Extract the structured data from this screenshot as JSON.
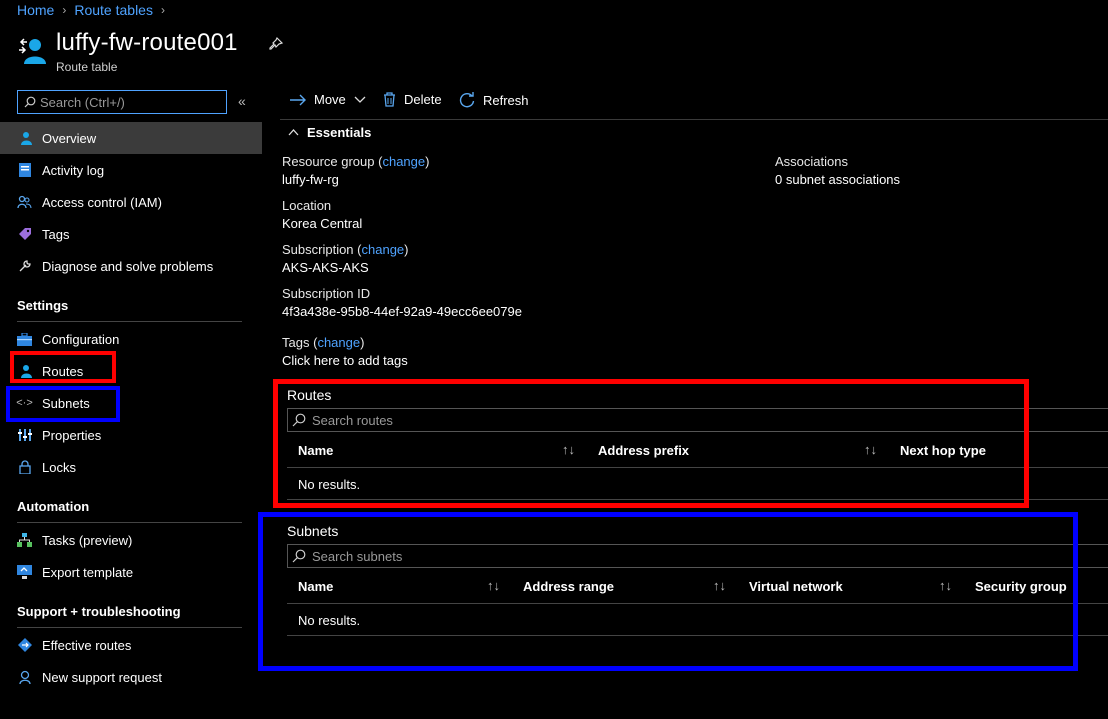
{
  "breadcrumb": {
    "home": "Home",
    "route_tables": "Route tables"
  },
  "header": {
    "title": "luffy-fw-route001",
    "subtitle": "Route table"
  },
  "sidebar": {
    "search_placeholder": "Search (Ctrl+/)",
    "items": {
      "overview": "Overview",
      "activity_log": "Activity log",
      "access_control": "Access control (IAM)",
      "tags": "Tags",
      "diagnose": "Diagnose and solve problems",
      "configuration": "Configuration",
      "routes": "Routes",
      "subnets": "Subnets",
      "properties": "Properties",
      "locks": "Locks",
      "tasks": "Tasks (preview)",
      "export_template": "Export template",
      "effective_routes": "Effective routes",
      "new_support_request": "New support request"
    },
    "sections": {
      "settings": "Settings",
      "automation": "Automation",
      "support": "Support + troubleshooting"
    }
  },
  "toolbar": {
    "move": "Move",
    "delete": "Delete",
    "refresh": "Refresh"
  },
  "essentials": {
    "title": "Essentials",
    "resource_group_label": "Resource group",
    "resource_group_value": "luffy-fw-rg",
    "location_label": "Location",
    "location_value": "Korea Central",
    "subscription_label": "Subscription",
    "subscription_value": "AKS-AKS-AKS",
    "subscription_id_label": "Subscription ID",
    "subscription_id_value": "4f3a438e-95b8-44ef-92a9-49ecc6ee079e",
    "tags_label": "Tags",
    "tags_value": "Click here to add tags",
    "associations_label": "Associations",
    "associations_value": "0 subnet associations",
    "change": "change",
    "paren_open": "(",
    "paren_close": ")"
  },
  "routes_grid": {
    "title": "Routes",
    "search_placeholder": "Search routes",
    "columns": [
      "Name",
      "Address prefix",
      "Next hop type"
    ],
    "empty": "No results."
  },
  "subnets_grid": {
    "title": "Subnets",
    "search_placeholder": "Search subnets",
    "columns": [
      "Name",
      "Address range",
      "Virtual network",
      "Security group"
    ],
    "empty": "No results."
  },
  "colors": {
    "accent": "#4fa3ff",
    "highlight_red": "#ff0000",
    "highlight_blue": "#0000ff",
    "active_bg": "#3b3b3b"
  }
}
